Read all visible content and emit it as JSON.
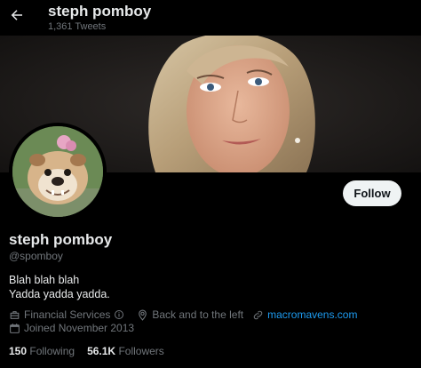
{
  "header": {
    "name": "steph pomboy",
    "tweet_count": "1,361 Tweets"
  },
  "profile": {
    "display_name": "steph pomboy",
    "handle": "@spomboy",
    "bio_line1": "Blah blah blah",
    "bio_line2": "Yadda yadda yadda.",
    "category": "Financial Services",
    "location": "Back and to the left",
    "website": "macromavens.com",
    "joined": "Joined November 2013",
    "following_count": "150",
    "following_label": "Following",
    "followers_count": "56.1K",
    "followers_label": "Followers"
  },
  "actions": {
    "follow_label": "Follow"
  },
  "colors": {
    "background": "#000000",
    "link": "#1d9bf0",
    "muted": "#71767b",
    "text": "#e7e9ea"
  }
}
